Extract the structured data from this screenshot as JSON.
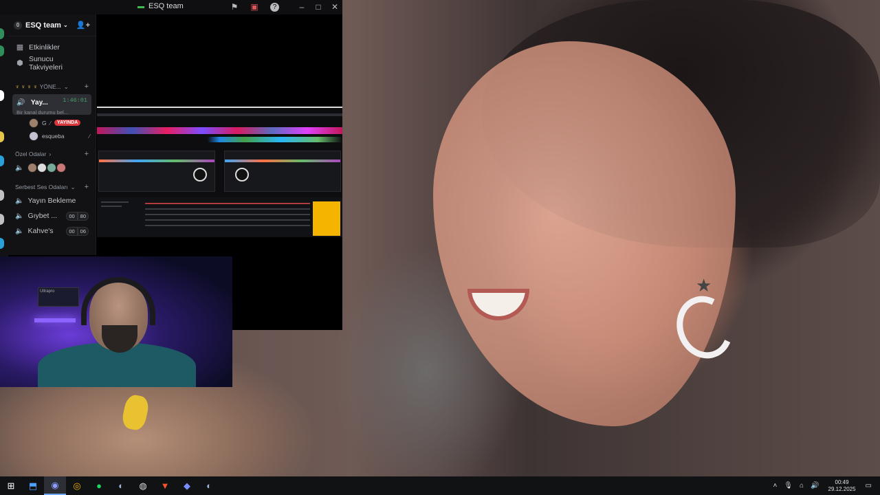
{
  "window": {
    "title": "ESQ team"
  },
  "sidebar": {
    "server_name": "ESQ team",
    "server_badge": "0",
    "nav": [
      {
        "label": "Etkinlikler",
        "icon": "calendar-icon"
      },
      {
        "label": "Sunucu Takviyeleri",
        "icon": "boost-icon"
      }
    ],
    "category_1": "YÖNE...",
    "active_channel": {
      "name": "Yay...",
      "timer": "1:46:01",
      "status": "Bir kanal durumu bel..."
    },
    "voice_users": [
      {
        "name": "G",
        "live": "YAYINDA"
      },
      {
        "name": "esqueba"
      }
    ],
    "category_2": "Özel Odalar",
    "category_3": "Serbest Ses Odaları",
    "voice_channels": [
      {
        "name": "Yayın Bekleme"
      },
      {
        "name": "Gıybet ...",
        "count": "00",
        "limit": "80"
      },
      {
        "name": "Kahve's",
        "count": "00",
        "limit": "06"
      }
    ]
  },
  "webcam": {
    "monitor_text": "Ultrapro"
  },
  "taskbar": {
    "time": "00:49",
    "date": "29.12.2025",
    "apps": [
      "start-icon",
      "file-explorer-icon",
      "discord-icon",
      "chrome-icon",
      "spotify-icon",
      "steam-icon",
      "obs-icon",
      "brave-icon",
      "app-icon",
      "steam-icon"
    ]
  },
  "colors": {
    "live_red": "#da373c",
    "timer_green": "#45a366",
    "discord_bg": "#121214",
    "taskbar_bg": "#101214"
  }
}
